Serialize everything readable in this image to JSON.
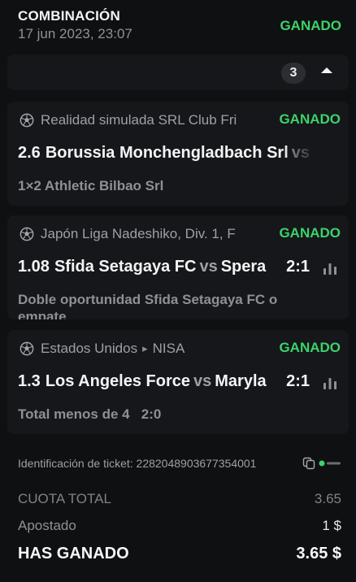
{
  "header": {
    "title": "COMBINACIÓN",
    "date": "17 jun 2023, 23:07",
    "status": "GANADO"
  },
  "summary": {
    "selection_count": "3"
  },
  "bets": [
    {
      "league": "Realidad simulada SRL Club Fri",
      "league_sub": "",
      "status": "GANADO",
      "odds": "2.6",
      "home": "Borussia Monchengladbach Srl",
      "vs": "vs",
      "away": "",
      "score": "",
      "market": "1×2 Athletic Bilbao Srl"
    },
    {
      "league": "Japón Liga Nadeshiko, Div. 1, F",
      "league_sub": "",
      "status": "GANADO",
      "odds": "1.08",
      "home": "Sfida Setagaya FC",
      "vs": "vs",
      "away": "Spera",
      "score": "2:1",
      "market": "Doble oportunidad Sfida Setagaya FC o empate"
    },
    {
      "league": "Estados Unidos",
      "league_sub": "NISA",
      "status": "GANADO",
      "odds": "1.3",
      "home": "Los Angeles Force",
      "vs": "vs",
      "away": "Maryla",
      "score": "2:1",
      "market": "Total menos de 4   2:0"
    }
  ],
  "ticket": {
    "label": "Identificación de ticket:",
    "id": "2282048903677354001"
  },
  "totals": {
    "total_odds_label": "CUOTA TOTAL",
    "total_odds": "3.65",
    "stake_label": "Apostado",
    "stake": "1 $",
    "won_label": "HAS GANADO",
    "won": "3.65 $"
  },
  "colors": {
    "win": "#3bd36a",
    "background": "#0f1012",
    "card": "#16171a"
  }
}
